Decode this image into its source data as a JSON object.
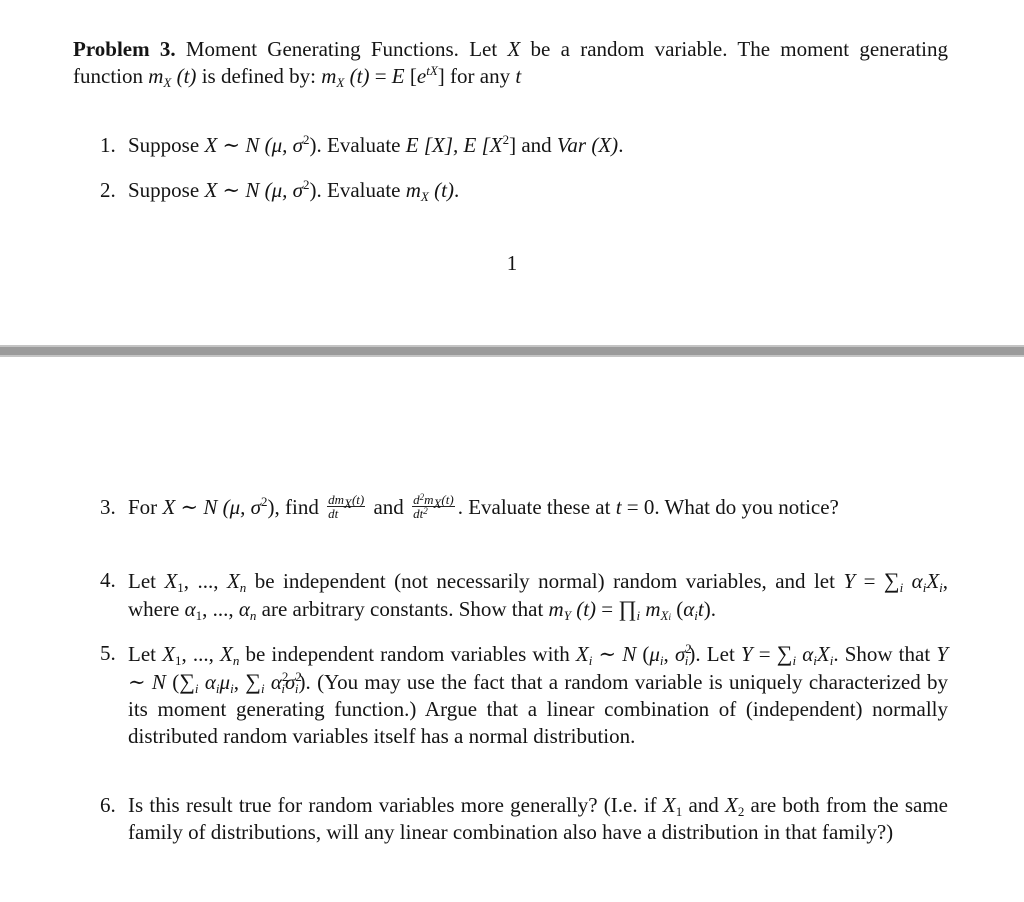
{
  "document": {
    "header": {
      "title_bold": "Problem 3.",
      "title_rest": " Moment Generating Functions. Let ",
      "var_X": "X",
      "after_X": " be a random variable. The moment generating function ",
      "m": "m",
      "sub_X": "X",
      "paren_t": " (t)",
      "is_defined": " is defined by: ",
      "equals_E": " = ",
      "E": "E",
      "bracket_open": " [",
      "e": "e",
      "sup_tX": "tX",
      "bracket_close": "]",
      "for_any": " for any ",
      "t": "t"
    },
    "items": [
      {
        "number": "1.",
        "pre": "Suppose ",
        "X": "X",
        "tilde": " ∼ ",
        "N": "N",
        "params_open": " (μ, σ",
        "sq": "2",
        "params_close": ").",
        "evaluate": " Evaluate ",
        "E1": "E",
        "bracket1": " [X], ",
        "E2": "E",
        "bracket2_open": " [X",
        "bracket2_close": "]",
        "and": " and ",
        "Var": "Var",
        "var_paren": " (X)",
        "end": "."
      },
      {
        "number": "2.",
        "pre": "Suppose ",
        "X": "X",
        "tilde": " ∼ ",
        "N": "N",
        "params_open": " (μ, σ",
        "sq": "2",
        "params_close": ").",
        "evaluate": " Evaluate ",
        "m": "m",
        "sub_X": "X",
        "paren_t": " (t)",
        "end": "."
      },
      {
        "number": "3.",
        "pre": "For ",
        "X": "X",
        "tilde": " ∼ ",
        "N": "N",
        "params_open": " (μ, σ",
        "sq": "2",
        "params_close": "),",
        "find": " find ",
        "frac1_num_d": "dm",
        "frac1_num_sub": "X",
        "frac1_num_t": "(t)",
        "frac1_den": "dt",
        "and": " and ",
        "frac2_num_d": "d",
        "frac2_num_sup": "2",
        "frac2_num_m": "m",
        "frac2_num_sub": "X",
        "frac2_num_t": "(t)",
        "frac2_den": "dt",
        "frac2_den_sup": "2",
        "after_frac": ". Evaluate these at ",
        "t": "t",
        "eq_zero": " = 0. What do you notice?"
      },
      {
        "number": "4.",
        "let": "Let ",
        "X": "X",
        "sub1": "1",
        "dots": ", ..., ",
        "Xn": "X",
        "subn": "n",
        "text1": " be independent (not necessarily normal) random variables, and let ",
        "Y": "Y",
        "equals": " = ",
        "sum": "∑",
        "sum_sub": "i",
        "alpha": "α",
        "alpha_sub": "i",
        "Xi": "X",
        "Xi_sub": "i",
        "where": ", where ",
        "alpha1": "α",
        "alpha1_sub": "1",
        "dots2": ", ..., ",
        "alphan": "α",
        "alphan_sub": "n",
        "text2": " are arbitrary constants. Show that ",
        "m": "m",
        "m_sub": "Y",
        "paren_t": " (t)",
        "eq": " = ",
        "prod": "∏",
        "prod_sub": "i",
        "m2": "m",
        "m2_sub": "X",
        "m2_subsub": "i",
        "paren_alpha_open": " (",
        "alpha_t": "α",
        "alpha_t_sub": "i",
        "t": "t",
        "paren_close": ")."
      },
      {
        "number": "5.",
        "let": "Let ",
        "X": "X",
        "sub1": "1",
        "dots": ", ..., ",
        "Xn": "X",
        "subn": "n",
        "text1": " be independent random variables with ",
        "Xi": "X",
        "Xi_sub": "i",
        "tilde": " ∼ ",
        "N": "N",
        "params_open": " (",
        "mu": "μ",
        "mu_sub": "i",
        "comma": ", ",
        "sigma": "σ",
        "sigma_sup": "2",
        "sigma_sub": "i",
        "params_close": ").",
        "let_Y": " Let ",
        "Y": "Y",
        "equals": " = ",
        "sum": "∑",
        "sum_sub": "i",
        "alpha": "α",
        "alpha_sub": "i",
        "Xi2": "X",
        "Xi2_sub": "i",
        "show": ". Show that ",
        "Y2": "Y",
        "tilde2": " ∼ ",
        "N2": "N",
        "open2": " (",
        "sum2": "∑",
        "sum2_sub": "i",
        "alpha2": "α",
        "alpha2_sub": "i",
        "mu2": "μ",
        "mu2_sub": "i",
        "comma2": ", ",
        "sum3": "∑",
        "sum3_sub": "i",
        "alpha3": "α",
        "alpha3_sup": "2",
        "alpha3_sub": "i",
        "sigma3": "σ",
        "sigma3_sup": "2",
        "sigma3_sub": "i",
        "close2": ").",
        "text2": " (You may use the fact that a random variable is uniquely characterized by its moment generating function.) Argue that a linear combination of (independent) normally distributed random variables itself has a normal distribution."
      },
      {
        "number": "6.",
        "text1": "Is this result true for random variables more generally? (I.e. if ",
        "X1": "X",
        "X1_sub": "1",
        "and": " and ",
        "X2": "X",
        "X2_sub": "2",
        "text2": " are both from the same family of distributions, will any linear combination also have a distribution in that family?)"
      }
    ],
    "page_number": "1",
    "colors": {
      "text": "#141414",
      "page_background": "#ffffff",
      "separator": "#9b9b9b",
      "separator_edge": "#c4c4c4"
    }
  }
}
